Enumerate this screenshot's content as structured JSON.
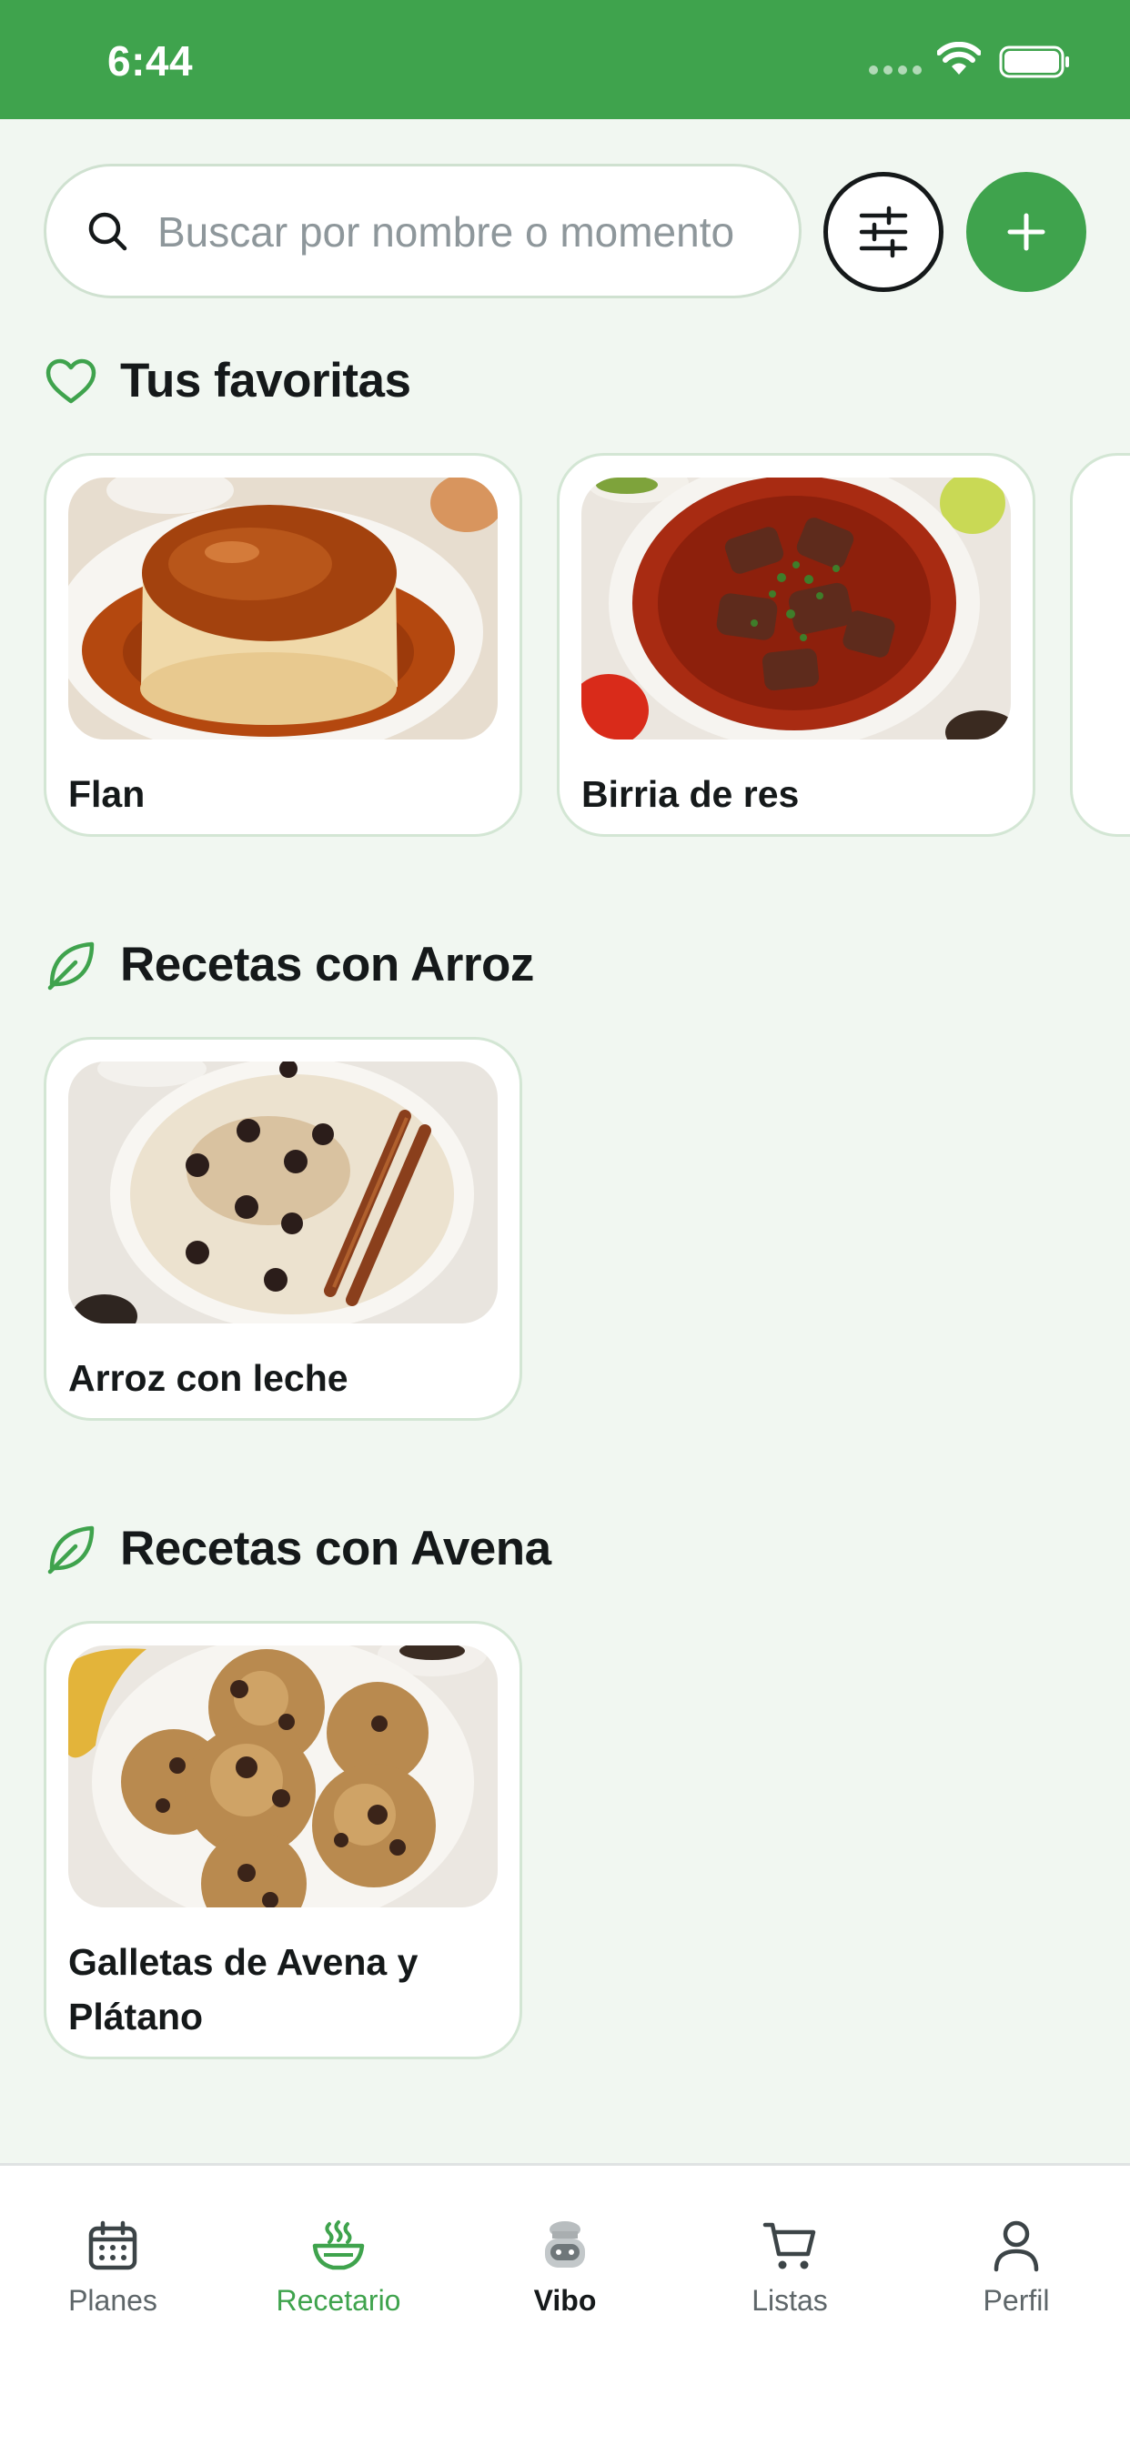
{
  "status_bar": {
    "time": "6:44"
  },
  "search": {
    "placeholder": "Buscar por nombre o momento"
  },
  "sections": [
    {
      "title": "Tus favoritas",
      "icon": "heart-icon",
      "cards": [
        {
          "title": "Flan"
        },
        {
          "title": "Birria de res"
        }
      ]
    },
    {
      "title": "Recetas con Arroz",
      "icon": "leaf-icon",
      "cards": [
        {
          "title": "Arroz con leche"
        }
      ]
    },
    {
      "title": "Recetas con Avena",
      "icon": "leaf-icon",
      "cards": [
        {
          "title": "Galletas de Avena y Plátano"
        }
      ]
    }
  ],
  "nav": {
    "items": [
      {
        "label": "Planes",
        "icon": "calendar-icon"
      },
      {
        "label": "Recetario",
        "icon": "bowl-icon",
        "active": true
      },
      {
        "label": "Vibo",
        "icon": "chef-robot-icon"
      },
      {
        "label": "Listas",
        "icon": "cart-icon"
      },
      {
        "label": "Perfil",
        "icon": "user-icon"
      }
    ]
  },
  "colors": {
    "accent": "#3fa34d",
    "background": "#f1f7f1",
    "text": "#15191a",
    "muted": "#5e6669"
  }
}
